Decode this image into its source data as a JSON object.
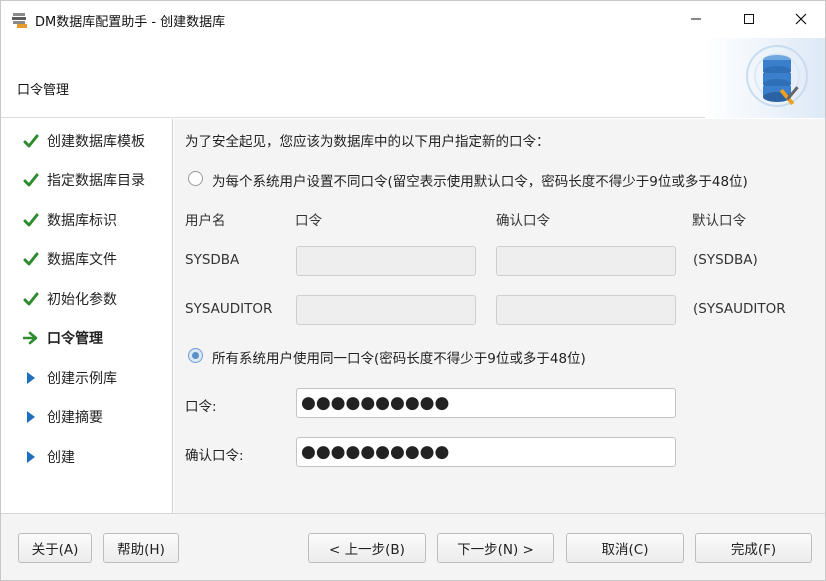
{
  "window": {
    "title": "DM数据库配置助手 - 创建数据库",
    "controls": {
      "minimize": "—",
      "maximize": "☐",
      "close": "✕"
    }
  },
  "header": {
    "title": "口令管理"
  },
  "nav": {
    "items": [
      {
        "label": "创建数据库模板",
        "state": "done"
      },
      {
        "label": "指定数据库目录",
        "state": "done"
      },
      {
        "label": "数据库标识",
        "state": "done"
      },
      {
        "label": "数据库文件",
        "state": "done"
      },
      {
        "label": "初始化参数",
        "state": "done"
      },
      {
        "label": "口令管理",
        "state": "current"
      },
      {
        "label": "创建示例库",
        "state": "pending"
      },
      {
        "label": "创建摘要",
        "state": "pending"
      },
      {
        "label": "创建",
        "state": "pending"
      }
    ]
  },
  "content": {
    "intro": "为了安全起见，您应该为数据库中的以下用户指定新的口令：",
    "option_individual": "为每个系统用户设置不同口令(留空表示使用默认口令，密码长度不得少于9位或多于48位)",
    "table": {
      "headers": {
        "user": "用户名",
        "password": "口令",
        "confirm": "确认口令",
        "default": "默认口令"
      },
      "rows": [
        {
          "user": "SYSDBA",
          "default": "(SYSDBA)"
        },
        {
          "user": "SYSAUDITOR",
          "default": "(SYSAUDITOR"
        }
      ]
    },
    "option_same": "所有系统用户使用同一口令(密码长度不得少于9位或多于48位)",
    "password_label": "口令:",
    "password_value": "●●●●●●●●●●",
    "confirm_label": "确认口令:",
    "confirm_value": "●●●●●●●●●●"
  },
  "footer": {
    "about": "关于(A)",
    "help": "帮助(H)",
    "prev": "< 上一步(B)",
    "next": "下一步(N) >",
    "cancel": "取消(C)",
    "finish": "完成(F)"
  },
  "colors": {
    "check": "#2e8b2e",
    "arrow_current": "#2e8b2e",
    "arrow_pending": "#1f6fbf",
    "radio": "#5b8fc9"
  }
}
